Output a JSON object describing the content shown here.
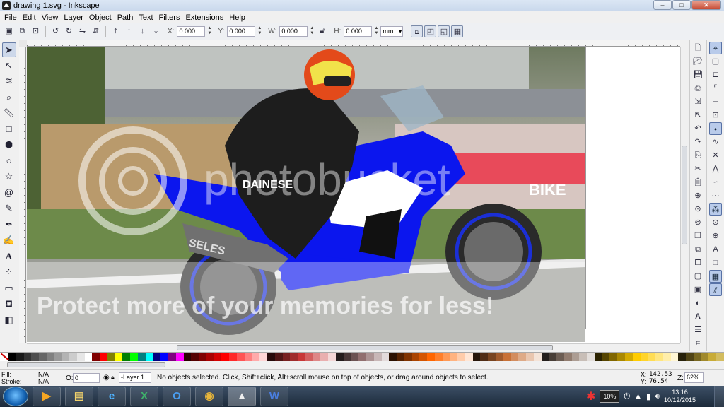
{
  "window": {
    "title": "drawing 1.svg - Inkscape",
    "controls": {
      "minimize": "–",
      "maximize": "□",
      "close": "✕"
    }
  },
  "menubar": [
    "File",
    "Edit",
    "View",
    "Layer",
    "Object",
    "Path",
    "Text",
    "Filters",
    "Extensions",
    "Help"
  ],
  "tool_controls": {
    "x_label": "X:",
    "x_value": "0.000",
    "y_label": "Y:",
    "y_value": "0.000",
    "w_label": "W:",
    "w_value": "0.000",
    "h_label": "H:",
    "h_value": "0.000",
    "unit": "mm"
  },
  "canvas": {
    "photo_top_watermark": "photobucket",
    "watermark_text": "Protect more of your memories for less!",
    "brand_decal": "DAINESE",
    "exhaust_decal": "SELES",
    "background_banner": "BIKE"
  },
  "status": {
    "fill_label": "Fill:",
    "fill_value": "N/A",
    "stroke_label": "Stroke:",
    "stroke_value": "N/A",
    "opacity_label": "O:",
    "opacity_value": "0",
    "layer": "-Layer 1",
    "message": "No objects selected. Click, Shift+click, Alt+scroll mouse on top of objects, or drag around objects to select.",
    "x_label": "X:",
    "x_value": "142.53",
    "y_label": "Y:",
    "y_value": "76.54",
    "zoom_label": "Z:",
    "zoom_value": "62%"
  },
  "taskbar": {
    "battery": "10%",
    "time": "13:16",
    "date": "10/12/2015",
    "apps": [
      "media-player",
      "file-explorer",
      "internet-explorer",
      "excel",
      "outlook",
      "chrome",
      "inkscape",
      "word"
    ]
  },
  "palette_colors": [
    "#000000",
    "#1a1a1a",
    "#333333",
    "#4d4d4d",
    "#666666",
    "#808080",
    "#999999",
    "#b3b3b3",
    "#cccccc",
    "#e6e6e6",
    "#ffffff",
    "#800000",
    "#ff0000",
    "#808000",
    "#ffff00",
    "#008000",
    "#00ff00",
    "#008080",
    "#00ffff",
    "#000080",
    "#0000ff",
    "#800080",
    "#ff00ff",
    "#2b0000",
    "#550000",
    "#800000",
    "#aa0000",
    "#d40000",
    "#ff0000",
    "#ff2a2a",
    "#ff5555",
    "#ff8080",
    "#ffaaaa",
    "#ffd5d5",
    "#280b0b",
    "#501616",
    "#782121",
    "#a02c2c",
    "#c83737",
    "#d35f5f",
    "#de8787",
    "#e9afaf",
    "#f4d7d7",
    "#241c1c",
    "#483737",
    "#6c5353",
    "#916f6f",
    "#ac9393",
    "#c8b7b7",
    "#e3dbdb",
    "#2b1100",
    "#552200",
    "#803300",
    "#aa4400",
    "#d45500",
    "#ff6600",
    "#ff7f2a",
    "#ff9955",
    "#ffb380",
    "#ffccaa",
    "#ffe6d5",
    "#28170b",
    "#502d16",
    "#784421",
    "#a05a2c",
    "#c87137",
    "#d38d5f",
    "#deaa87",
    "#e9c6af",
    "#f4e3d7",
    "#241f1c",
    "#483e37",
    "#6c5d53",
    "#917c6f",
    "#ac9d93",
    "#c8beb7",
    "#e3dedb",
    "#2b2200",
    "#554400",
    "#806600",
    "#aa8800",
    "#d4aa00",
    "#ffcc00",
    "#ffd42a",
    "#ffdd55",
    "#ffe680",
    "#ffeeaa",
    "#fff6d5",
    "#28220b",
    "#504416",
    "#786721",
    "#a0892c",
    "#c8ab37",
    "#d3bc5f"
  ]
}
